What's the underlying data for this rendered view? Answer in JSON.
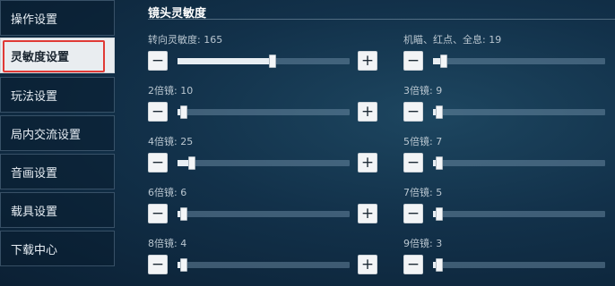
{
  "sidebar": {
    "items": [
      {
        "label": "操作设置",
        "active": false
      },
      {
        "label": "灵敏度设置",
        "active": true
      },
      {
        "label": "玩法设置",
        "active": false
      },
      {
        "label": "局内交流设置",
        "active": false
      },
      {
        "label": "音画设置",
        "active": false
      },
      {
        "label": "载具设置",
        "active": false
      },
      {
        "label": "下载中心",
        "active": false
      }
    ]
  },
  "section": {
    "title": "镜头灵敏度"
  },
  "controls": {
    "minus": "−",
    "plus": "+"
  },
  "settings": [
    {
      "label": "转向灵敏度: 165",
      "value": 165,
      "max": 300
    },
    {
      "label": "机瞄、红点、全息: 19",
      "value": 19,
      "max": 300
    },
    {
      "label": "2倍镜: 10",
      "value": 10,
      "max": 300
    },
    {
      "label": "3倍镜: 9",
      "value": 9,
      "max": 300
    },
    {
      "label": "4倍镜: 25",
      "value": 25,
      "max": 300
    },
    {
      "label": "5倍镜: 7",
      "value": 7,
      "max": 300
    },
    {
      "label": "6倍镜: 6",
      "value": 6,
      "max": 300
    },
    {
      "label": "7倍镜: 5",
      "value": 5,
      "max": 300
    },
    {
      "label": "8倍镜: 4",
      "value": 4,
      "max": 300
    },
    {
      "label": "9倍镜: 3",
      "value": 3,
      "max": 300
    }
  ]
}
